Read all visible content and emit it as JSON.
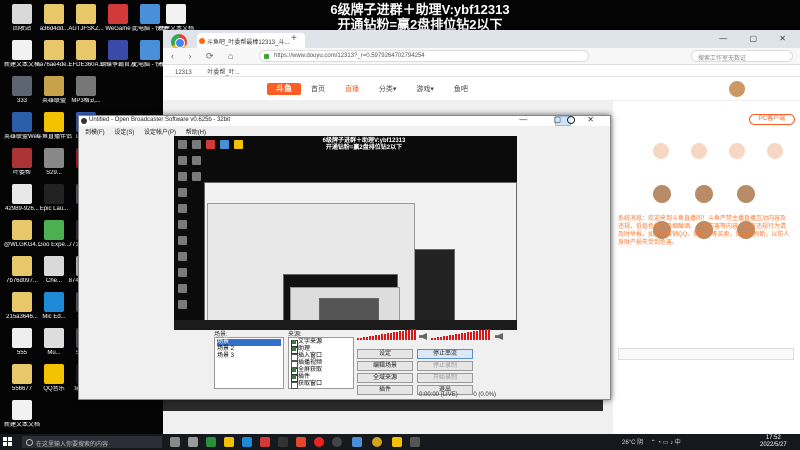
{
  "overlay": {
    "line1": "6级牌子进群＋助理V:ybf12313",
    "line2": "开通钻粉=赢2盘排位钻2以下"
  },
  "desktop": {
    "icons": [
      {
        "label": "回收站",
        "color": "#d9d9d9"
      },
      {
        "label": "a36d4dd...",
        "color": "#e8c66a"
      },
      {
        "label": "AUTJFSKZ...",
        "color": "#e8c66a"
      },
      {
        "label": "WeGame",
        "color": "#d23a3a"
      },
      {
        "label": "此电脑 - 快捷方式",
        "color": "#4a90d9"
      },
      {
        "label": "新建文本文档",
        "color": "#f2f2f2"
      },
      {
        "label": "新建文本文档",
        "color": "#f2f2f2"
      },
      {
        "label": "ea76ae4de...",
        "color": "#e8c66a"
      },
      {
        "label": "EFDE360A...",
        "color": "#e8c66a"
      },
      {
        "label": "蝴蝶争霸官方电竞平台",
        "color": "#3a4aa8"
      },
      {
        "label": "此电脑 - 快捷方式",
        "color": "#4a90d9"
      },
      {
        "label": "聚流多开器4",
        "color": "#f2c200"
      },
      {
        "label": "333",
        "color": "#5b6470"
      },
      {
        "label": "英雄联盟",
        "color": "#c8a24a"
      },
      {
        "label": "MP3格式...",
        "color": "#777"
      },
      {
        "label": "英雄联盟WeGame版",
        "color": "#2a5ea8"
      },
      {
        "label": "斗鱼直播伴侣",
        "color": "#f2c200"
      },
      {
        "label": "DetailQ",
        "color": "#3a66c4"
      },
      {
        "label": "叶委帮",
        "color": "#aa3333"
      },
      {
        "label": "S29...",
        "color": "#888"
      },
      {
        "label": "Sifu",
        "color": "#c02020"
      },
      {
        "label": "42989-926...",
        "color": "#e8e8e8"
      },
      {
        "label": "Epic Lau...",
        "color": "#222"
      },
      {
        "label": "333",
        "color": "#5b6470"
      },
      {
        "label": "@WLGKG4...",
        "color": "#e8c66a"
      },
      {
        "label": "Goo Expe...",
        "color": "#4caf50"
      },
      {
        "label": "771a6cb6e...",
        "color": "#3a3a3a"
      },
      {
        "label": "7b76d097...",
        "color": "#e8c66a"
      },
      {
        "label": "Che...",
        "color": "#d9d9d9"
      },
      {
        "label": "874c29635...",
        "color": "#d8d8d8"
      },
      {
        "label": "215a3646...",
        "color": "#e8c66a"
      },
      {
        "label": "Mic Ed...",
        "color": "#1e8ad6"
      },
      {
        "label": "44444",
        "color": "#5b6470"
      },
      {
        "label": "555",
        "color": "#eee"
      },
      {
        "label": "Mu...",
        "color": "#ddd"
      },
      {
        "label": "556678",
        "color": "#5b6470"
      },
      {
        "label": "556677",
        "color": "#e8c66a"
      },
      {
        "label": "QQ音乐",
        "color": "#f2c200"
      },
      {
        "label": "穿越火线",
        "color": "#222"
      },
      {
        "label": "新建文本文档(4)",
        "color": "#f2f2f2"
      }
    ]
  },
  "browser": {
    "tab_title": "斗鱼吧_叶委帮最棒12313_斗...",
    "url": "https://www.douyu.com/12313?_r=0.5979264702794254",
    "search_placeholder": "搜索工作室无数证",
    "bookmarks": [
      "12313",
      "叶委帮_叶..."
    ],
    "site_logo": "斗鱼",
    "site_nav": [
      "首页",
      "直播",
      "分类▾",
      "游戏▾",
      "鱼吧"
    ],
    "pc_button": "PC客户端",
    "chat_text": "系统消息：欢迎来到斗鱼直播间！斗鱼严禁主播直播互动内容及违规，低俗色情、吸烟酗酒、人身伤害等内容，若有违规行为请及时举报。如主播推销QQ、微信号等买卖，请谨慎判断，以防人身财产损失受到危害。"
  },
  "obs": {
    "title": "Untitled - Open Broadcaster Software v0.625b - 32bit",
    "menu": [
      "到模(F)",
      "设定(S)",
      "设定帐户(P)",
      "帮助(H)"
    ],
    "preview_banner_1": "6级牌子进群＋助理V:ybf12313",
    "preview_banner_2": "开通钻粉=赢2盘排位钻2以下",
    "scenes_label": "场景:",
    "scenes": [
      "场景",
      "场景 2",
      "场景 3"
    ],
    "sources_label": "来源:",
    "sources": [
      {
        "label": "文字来源",
        "checked": true
      },
      {
        "label": "助理",
        "checked": true
      },
      {
        "label": "插入窗口",
        "checked": false
      },
      {
        "label": "插播视频",
        "checked": false
      },
      {
        "label": "全屏获取",
        "checked": true
      },
      {
        "label": "插件",
        "checked": true
      },
      {
        "label": "获取窗口",
        "checked": false
      }
    ],
    "buttons": {
      "settings": "设定",
      "stop_stream": "停止串流",
      "edit_scene": "编辑场景",
      "stop_preview": "停止预览",
      "global_sources": "全域来源",
      "plugins": "插件",
      "exit": "退出",
      "dim1": "停止录制",
      "dim2": "开始录制"
    },
    "status": "0:00:00 (LIVE)",
    "status_extra": "0 (0.0%)"
  },
  "taskbar": {
    "search_placeholder": "在这里输入你要搜索的内容",
    "tray_text": "26°C 阴",
    "time": "17:52",
    "date": "2022/5/27"
  }
}
